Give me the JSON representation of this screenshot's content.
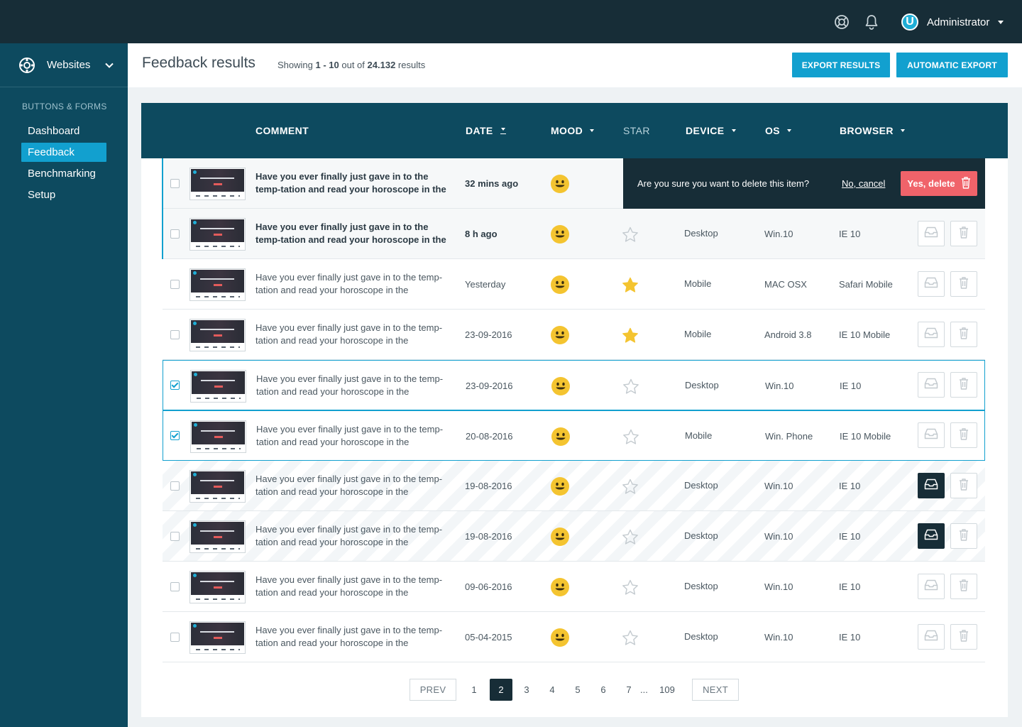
{
  "topbar": {
    "user_initial": "U",
    "user_name": "Administrator",
    "icons": [
      "lifebuoy-icon",
      "bell-icon",
      "chevron-down-icon"
    ]
  },
  "sidebar": {
    "switcher_label": "Websites",
    "section_title": "BUTTONS & FORMS",
    "items": [
      {
        "label": "Dashboard",
        "active": false
      },
      {
        "label": "Feedback",
        "active": true
      },
      {
        "label": "Benchmarking",
        "active": false
      },
      {
        "label": "Setup",
        "active": false
      }
    ]
  },
  "header": {
    "title": "Feedback results",
    "showing_prefix": "Showing",
    "range": "1 - 10",
    "out_of": "out of",
    "total": "24.132",
    "results_word": "results",
    "export_label": "EXPORT RESULTS",
    "auto_export_label": "AUTOMATIC EXPORT"
  },
  "table": {
    "columns": {
      "comment": "COMMENT",
      "date": "DATE",
      "mood": "MOOD",
      "star": "STAR",
      "device": "DEVICE",
      "os": "OS",
      "browser": "BROWSER"
    },
    "confirm": {
      "question": "Are you sure you want to delete this item?",
      "cancel": "No, cancel",
      "confirm": "Yes, delete"
    },
    "rows": [
      {
        "comment": "Have you ever finally just gave in to the temp-tation and read your horoscope in the",
        "date": "32 mins ago",
        "starred": false,
        "device": "",
        "os": "",
        "browser": "",
        "unread": true,
        "checked": false,
        "archived": false,
        "confirm_delete": true
      },
      {
        "comment": "Have you ever finally just gave in to the temp-tation and read your horoscope in the",
        "date": "8 h ago",
        "starred": false,
        "device": "Desktop",
        "os": "Win.10",
        "browser": "IE 10",
        "unread": true,
        "checked": false,
        "archived": false,
        "confirm_delete": false
      },
      {
        "comment": "Have you ever finally just gave in to the temp-tation and read your horoscope in the",
        "date": "Yesterday",
        "starred": true,
        "device": "Mobile",
        "os": "MAC OSX",
        "browser": "Safari Mobile",
        "unread": false,
        "checked": false,
        "archived": false,
        "confirm_delete": false
      },
      {
        "comment": "Have you ever finally just gave in to the temp-tation and read your horoscope in the",
        "date": "23-09-2016",
        "starred": true,
        "device": "Mobile",
        "os": "Android 3.8",
        "browser": "IE 10 Mobile",
        "unread": false,
        "checked": false,
        "archived": false,
        "confirm_delete": false
      },
      {
        "comment": "Have you ever finally just gave in to the temp-tation and read your horoscope in the",
        "date": "23-09-2016",
        "starred": false,
        "device": "Desktop",
        "os": "Win.10",
        "browser": "IE 10",
        "unread": false,
        "checked": true,
        "archived": false,
        "confirm_delete": false
      },
      {
        "comment": "Have you ever finally just gave in to the temp-tation and read your horoscope in the",
        "date": "20-08-2016",
        "starred": false,
        "device": "Mobile",
        "os": "Win. Phone",
        "browser": "IE 10 Mobile",
        "unread": false,
        "checked": true,
        "archived": false,
        "confirm_delete": false
      },
      {
        "comment": "Have you ever finally just gave in to the temp-tation and read your horoscope in the",
        "date": "19-08-2016",
        "starred": false,
        "device": "Desktop",
        "os": "Win.10",
        "browser": "IE 10",
        "unread": false,
        "checked": false,
        "archived": true,
        "confirm_delete": false
      },
      {
        "comment": "Have you ever finally just gave in to the temp-tation and read your horoscope in the",
        "date": "19-08-2016",
        "starred": false,
        "device": "Desktop",
        "os": "Win.10",
        "browser": "IE 10",
        "unread": false,
        "checked": false,
        "archived": true,
        "confirm_delete": false
      },
      {
        "comment": "Have you ever finally just gave in to the temp-tation and read your horoscope in the",
        "date": "09-06-2016",
        "starred": false,
        "device": "Desktop",
        "os": "Win.10",
        "browser": "IE 10",
        "unread": false,
        "checked": false,
        "archived": false,
        "confirm_delete": false
      },
      {
        "comment": "Have you ever finally just gave in to the temp-tation and read your horoscope in the",
        "date": "05-04-2015",
        "starred": false,
        "device": "Desktop",
        "os": "Win.10",
        "browser": "IE 10",
        "unread": false,
        "checked": false,
        "archived": false,
        "confirm_delete": false
      }
    ]
  },
  "pagination": {
    "prev": "PREV",
    "next": "NEXT",
    "pages": [
      "1",
      "2",
      "3",
      "4",
      "5",
      "6",
      "7"
    ],
    "current": "2",
    "ellipsis": "...",
    "last": "109"
  },
  "colors": {
    "topbar": "#172d37",
    "sidebar": "#0d4a5f",
    "accent": "#12a0cf",
    "danger": "#f0636a",
    "mood": "#f4c430",
    "star": "#f4c430"
  }
}
